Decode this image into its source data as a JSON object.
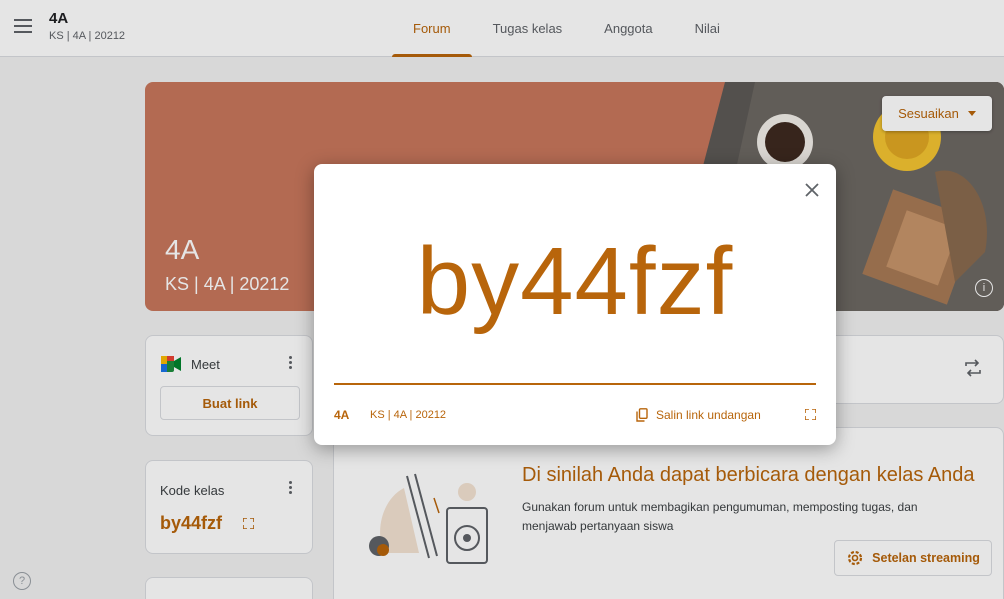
{
  "header": {
    "class_name": "4A",
    "class_section": "KS | 4A | 20212",
    "tabs": [
      {
        "label": "Forum",
        "active": true
      },
      {
        "label": "Tugas kelas",
        "active": false
      },
      {
        "label": "Anggota",
        "active": false
      },
      {
        "label": "Nilai",
        "active": false
      }
    ]
  },
  "banner": {
    "title": "4A",
    "subtitle": "KS | 4A | 20212",
    "customize_label": "Sesuaikan",
    "info_icon": "i",
    "color": "#c8775c"
  },
  "meet": {
    "label": "Meet",
    "button_label": "Buat link"
  },
  "class_code": {
    "label": "Kode kelas",
    "value": "by44fzf"
  },
  "help_icon": "?",
  "welcome": {
    "title": "Di sinilah Anda dapat berbicara dengan kelas Anda",
    "description": "Gunakan forum untuk membagikan pengumuman, memposting tugas, dan menjawab pertanyaan siswa",
    "stream_settings_label": "Setelan streaming"
  },
  "dialog": {
    "code": "by44fzf",
    "class_name": "4A",
    "class_section": "KS | 4A | 20212",
    "copy_link_label": "Salin link undangan"
  },
  "colors": {
    "accent": "#b8650b",
    "banner": "#c8775c"
  }
}
